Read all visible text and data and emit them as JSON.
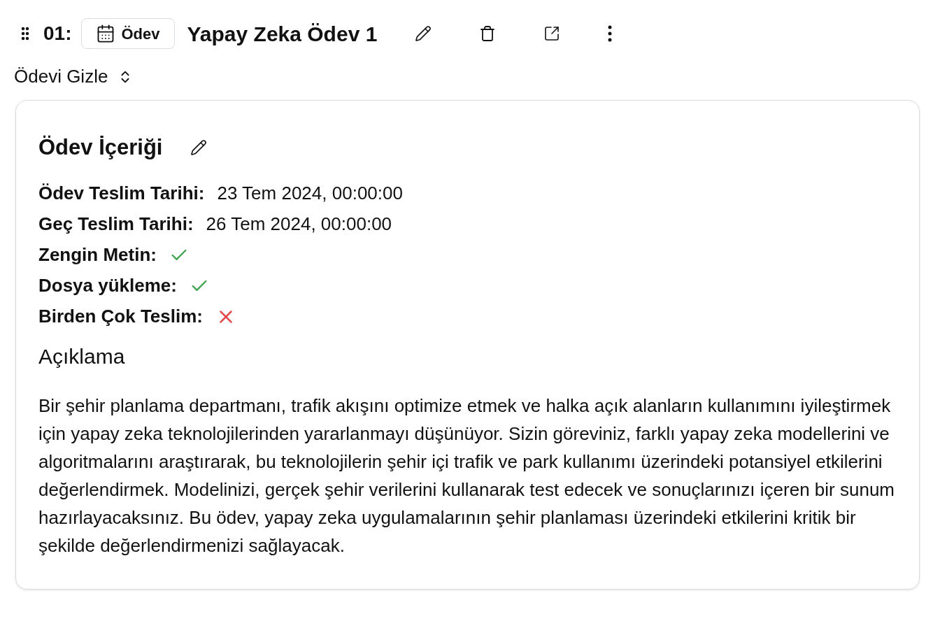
{
  "header": {
    "number": "01:",
    "tag": "Ödev",
    "title": "Yapay Zeka Ödev 1"
  },
  "toggle": {
    "label": "Ödevi Gizle"
  },
  "card": {
    "title": "Ödev İçeriği",
    "fields": [
      {
        "kind": "text",
        "label": "Ödev Teslim Tarihi:",
        "value": "23 Tem 2024, 00:00:00"
      },
      {
        "kind": "text",
        "label": "Geç Teslim Tarihi:",
        "value": "26 Tem 2024, 00:00:00"
      },
      {
        "kind": "bool",
        "label": "Zengin Metin:",
        "on": true
      },
      {
        "kind": "bool",
        "label": "Dosya yükleme:",
        "on": true
      },
      {
        "kind": "bool",
        "label": "Birden Çok Teslim:",
        "on": false
      }
    ],
    "description_heading": "Açıklama",
    "description": "Bir şehir planlama departmanı, trafik akışını optimize etmek ve halka açık alanların kullanımını iyileştirmek için yapay zeka teknolojilerinden yararlanmayı düşünüyor. Sizin göreviniz, farklı yapay zeka modellerini ve algoritmalarını araştırarak, bu teknolojilerin şehir içi trafik ve park kullanımı üzerindeki potansiyel etkilerini değerlendirmek. Modelinizi, gerçek şehir verilerini kullanarak test edecek ve sonuçlarınızı içeren bir sunum hazırlayacaksınız. Bu ödev, yapay zeka uygulamalarının şehir planlaması üzerindeki etkilerini kritik bir şekilde değerlendirmenizi sağlayacak."
  }
}
